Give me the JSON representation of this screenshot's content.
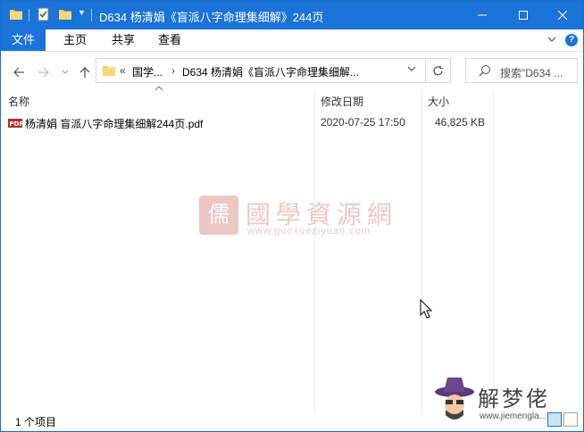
{
  "window": {
    "title": "D634 杨清娟《盲派八字命理集细解》244页"
  },
  "ribbon": {
    "tabs": [
      "文件",
      "主页",
      "共享",
      "查看"
    ]
  },
  "address": {
    "crumb_overflow": "«",
    "crumbs": [
      "国学...",
      "D634 杨清娟《盲派八字命理集细解..."
    ]
  },
  "search": {
    "placeholder": "搜索\"D634 ..."
  },
  "columns": {
    "name": "名称",
    "date": "修改日期",
    "size": "大小"
  },
  "files": [
    {
      "name": "杨清娟 盲派八字命理集细解244页.pdf",
      "modified": "2020-07-25 17:50",
      "size": "46,825 KB",
      "icon": "pdf-icon"
    }
  ],
  "watermark": {
    "text": "國學資源網",
    "url": "www.guoxueziyuan.com"
  },
  "corner_logo": {
    "text": "解梦佬",
    "url": "www.jiemengla..."
  },
  "status": {
    "item_count": "1 个项目"
  },
  "colors": {
    "accent": "#1a73d9",
    "watermark": "#c0392b"
  }
}
